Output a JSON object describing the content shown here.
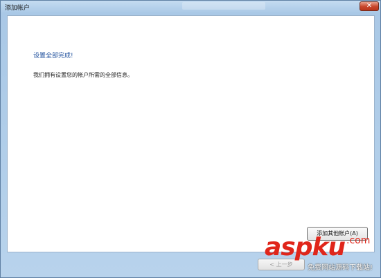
{
  "window": {
    "title": "添加帐户",
    "close_glyph": "✕"
  },
  "content": {
    "heading": "设置全部完成!",
    "message": "我们拥有设置您的帐户所需的全部信息。"
  },
  "buttons": {
    "add_other_account": "添加其他帐户(A)",
    "previous": "< 上一步"
  },
  "watermark": {
    "main": "aspku",
    "suffix": ".com",
    "sub": "免费网站源码下载站!"
  },
  "colors": {
    "heading": "#1e4f9c",
    "watermark": "#e0261b",
    "title_bar": "#b8d3ec"
  }
}
